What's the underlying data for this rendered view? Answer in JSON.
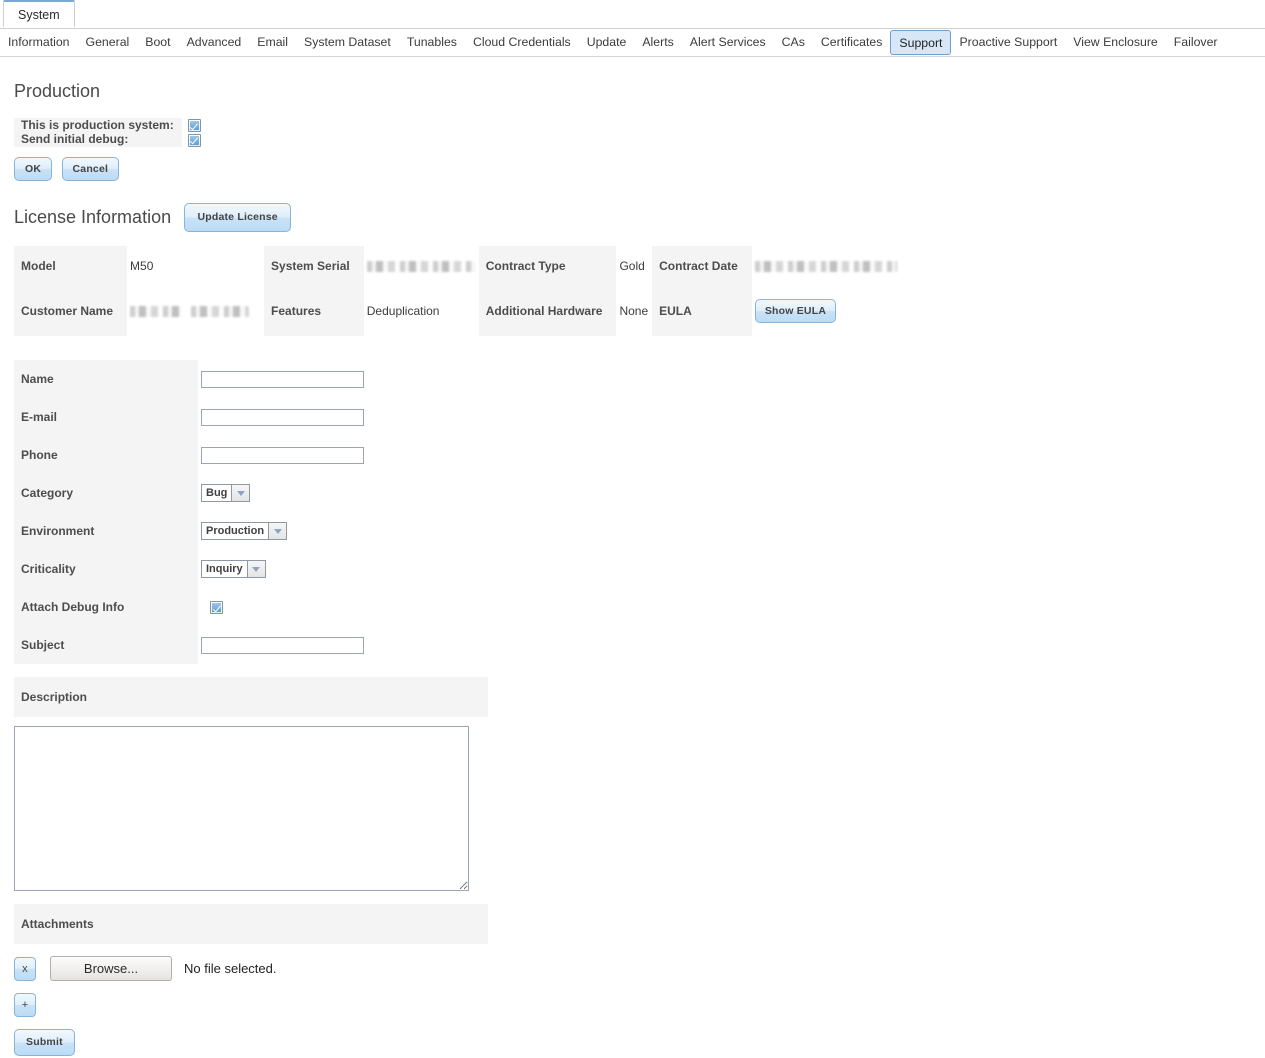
{
  "window": {
    "tab_label": "System"
  },
  "nav": {
    "items": [
      {
        "label": "Information",
        "selected": false
      },
      {
        "label": "General",
        "selected": false
      },
      {
        "label": "Boot",
        "selected": false
      },
      {
        "label": "Advanced",
        "selected": false
      },
      {
        "label": "Email",
        "selected": false
      },
      {
        "label": "System Dataset",
        "selected": false
      },
      {
        "label": "Tunables",
        "selected": false
      },
      {
        "label": "Cloud Credentials",
        "selected": false
      },
      {
        "label": "Update",
        "selected": false
      },
      {
        "label": "Alerts",
        "selected": false
      },
      {
        "label": "Alert Services",
        "selected": false
      },
      {
        "label": "CAs",
        "selected": false
      },
      {
        "label": "Certificates",
        "selected": false
      },
      {
        "label": "Support",
        "selected": true
      },
      {
        "label": "Proactive Support",
        "selected": false
      },
      {
        "label": "View Enclosure",
        "selected": false
      },
      {
        "label": "Failover",
        "selected": false
      }
    ]
  },
  "production": {
    "title": "Production",
    "rows": [
      {
        "label": "This is production system:",
        "checked": true
      },
      {
        "label": "Send initial debug:",
        "checked": true
      }
    ],
    "ok_label": "OK",
    "cancel_label": "Cancel"
  },
  "license": {
    "title": "License Information",
    "update_button": "Update License",
    "row1": {
      "model_label": "Model",
      "model_value": "M50",
      "serial_label": "System Serial",
      "serial_value": "",
      "contract_type_label": "Contract Type",
      "contract_type_value": "Gold",
      "contract_date_label": "Contract Date",
      "contract_date_value": ""
    },
    "row2": {
      "customer_label": "Customer Name",
      "customer_value": "",
      "features_label": "Features",
      "features_value": "Deduplication",
      "hardware_label": "Additional Hardware",
      "hardware_value": "None",
      "eula_label": "EULA",
      "eula_button": "Show EULA"
    }
  },
  "support_form": {
    "name_label": "Name",
    "name_value": "",
    "email_label": "E-mail",
    "email_value": "",
    "phone_label": "Phone",
    "phone_value": "",
    "category_label": "Category",
    "category_value": "Bug",
    "environment_label": "Environment",
    "environment_value": "Production",
    "criticality_label": "Criticality",
    "criticality_value": "Inquiry",
    "attach_debug_label": "Attach Debug Info",
    "attach_debug_checked": true,
    "subject_label": "Subject",
    "subject_value": "",
    "description_label": "Description",
    "description_value": "",
    "attachments_label": "Attachments",
    "remove_attachment_label": "x",
    "browse_label": "Browse...",
    "file_status": "No file selected.",
    "add_attachment_label": "+",
    "submit_label": "Submit"
  },
  "colors": {
    "accent": "#6f9fd0",
    "tab_active_bg": "#d7e7f8",
    "label_bg": "#f4f4f4",
    "button_border": "#8ab3d8"
  }
}
